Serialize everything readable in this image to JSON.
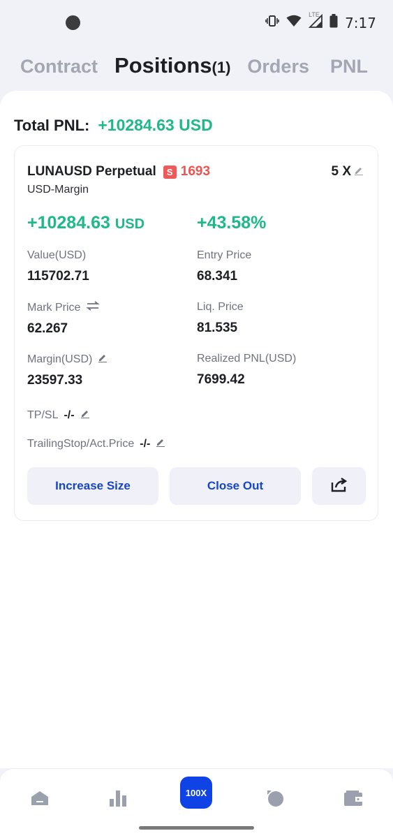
{
  "status_bar": {
    "time": "7:17",
    "network": "LTE",
    "icons": [
      "vibrate-icon",
      "wifi-icon",
      "signal-icon",
      "battery-icon"
    ]
  },
  "tabs": {
    "contract": "Contract",
    "positions": "Positions",
    "positions_count": "(1)",
    "orders": "Orders",
    "pnl": "PNL"
  },
  "summary": {
    "total_pnl_label": "Total PNL:",
    "total_pnl_value": "+10284.63 USD"
  },
  "position": {
    "symbol": "LUNAUSD Perpetual",
    "side_badge": "S",
    "quantity": "1693",
    "leverage": "5 X",
    "margin_type": "USD-Margin",
    "unrealized_pnl": "+10284.63",
    "unrealized_pnl_unit": "USD",
    "pnl_percent": "+43.58%",
    "value_label": "Value(USD)",
    "value": "115702.71",
    "entry_price_label": "Entry Price",
    "entry_price": "68.341",
    "mark_price_label": "Mark Price",
    "mark_price": "62.267",
    "liq_price_label": "Liq. Price",
    "liq_price": "81.535",
    "margin_label": "Margin(USD)",
    "margin": "23597.33",
    "realized_pnl_label": "Realized PNL(USD)",
    "realized_pnl": "7699.42",
    "tpsl_label": "TP/SL",
    "tpsl_value": "-/-",
    "trailing_label": "TrailingStop/Act.Price",
    "trailing_value": "-/-"
  },
  "actions": {
    "increase_size": "Increase Size",
    "close_out": "Close Out"
  },
  "bottom_nav": {
    "trade_label": "100X"
  },
  "colors": {
    "profit_green": "#1fb88a",
    "short_red": "#ef5350",
    "accent_blue": "#1043e6",
    "button_text_blue": "#1645c8"
  }
}
